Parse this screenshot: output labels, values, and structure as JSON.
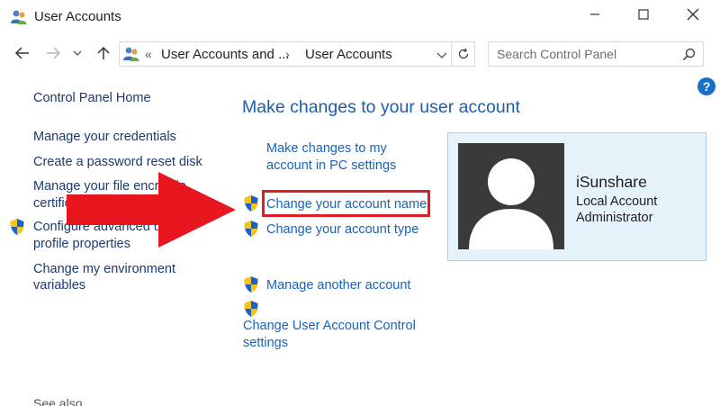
{
  "window": {
    "title": "User Accounts"
  },
  "address_bar": {
    "overflow": "«",
    "crumb_1": "User Accounts and ...",
    "separator": "›",
    "crumb_2": "User Accounts",
    "search_placeholder": "Search Control Panel"
  },
  "help_label": "?",
  "left_pane": {
    "home": "Control Panel Home",
    "items": [
      {
        "label_1": "Manage your credentials"
      },
      {
        "label_1": "Create a password reset disk"
      },
      {
        "label_1": "Manage your file encryptio",
        "label_2": "certifica"
      },
      {
        "label_1": "Configure advanced user",
        "label_2": "profile properties"
      },
      {
        "label_1": "Change my environment",
        "label_2": "variables"
      }
    ],
    "see_also": "See also"
  },
  "main": {
    "heading": "Make changes to your user account",
    "tasks": {
      "pc_settings_1": "Make changes to my",
      "pc_settings_2": "account in PC settings",
      "change_name": "Change your account name",
      "change_type": "Change your account type",
      "manage_another": "Manage another account",
      "uac_1": "Change User Account Control",
      "uac_2": "settings"
    }
  },
  "account": {
    "name": "iSunshare",
    "type": "Local Account",
    "role": "Administrator"
  },
  "colors": {
    "link": "#1a63b5",
    "heading": "#1a5fa8",
    "card_bg": "#e7f3fb",
    "highlight": "#e01d24",
    "arrow": "#e8161e"
  }
}
